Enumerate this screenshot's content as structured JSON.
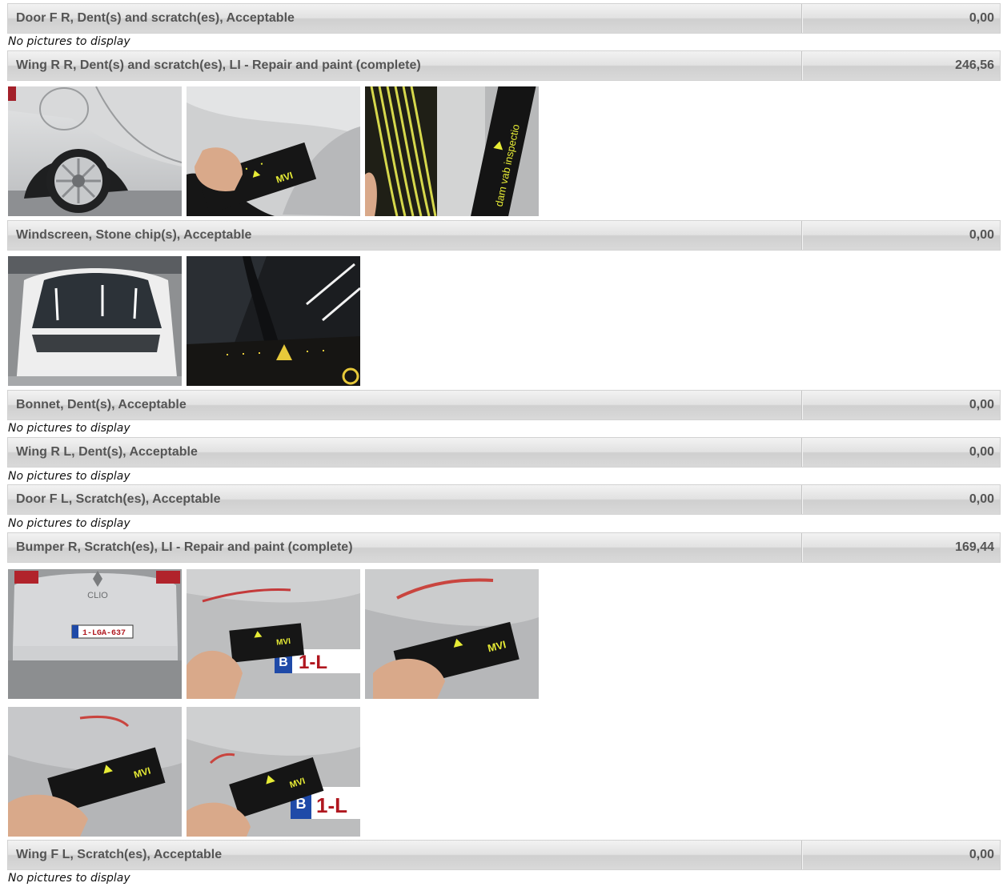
{
  "no_pictures_text": "No pictures to display",
  "items": [
    {
      "label": "Door F R, Dent(s) and scratch(es), Acceptable",
      "amount": "0,00"
    },
    {
      "label": "Wing R R, Dent(s) and scratch(es), LI - Repair and paint (complete)",
      "amount": "246,56"
    },
    {
      "label": "Windscreen, Stone chip(s), Acceptable",
      "amount": "0,00"
    },
    {
      "label": "Bonnet, Dent(s), Acceptable",
      "amount": "0,00"
    },
    {
      "label": "Wing R L, Dent(s), Acceptable",
      "amount": "0,00"
    },
    {
      "label": "Door F L, Scratch(es), Acceptable",
      "amount": "0,00"
    },
    {
      "label": "Bumper R, Scratch(es), LI - Repair and paint (complete)",
      "amount": "169,44"
    },
    {
      "label": "Wing F L, Scratch(es), Acceptable",
      "amount": "0,00"
    }
  ],
  "photo_text": {
    "gauge_brand": "MVI",
    "gauge_side_text": "dam vab inspectio",
    "car_model": "CLIO",
    "plate": "1-LGA-637",
    "plate_country": "B",
    "plate_fragment": "1-L"
  }
}
